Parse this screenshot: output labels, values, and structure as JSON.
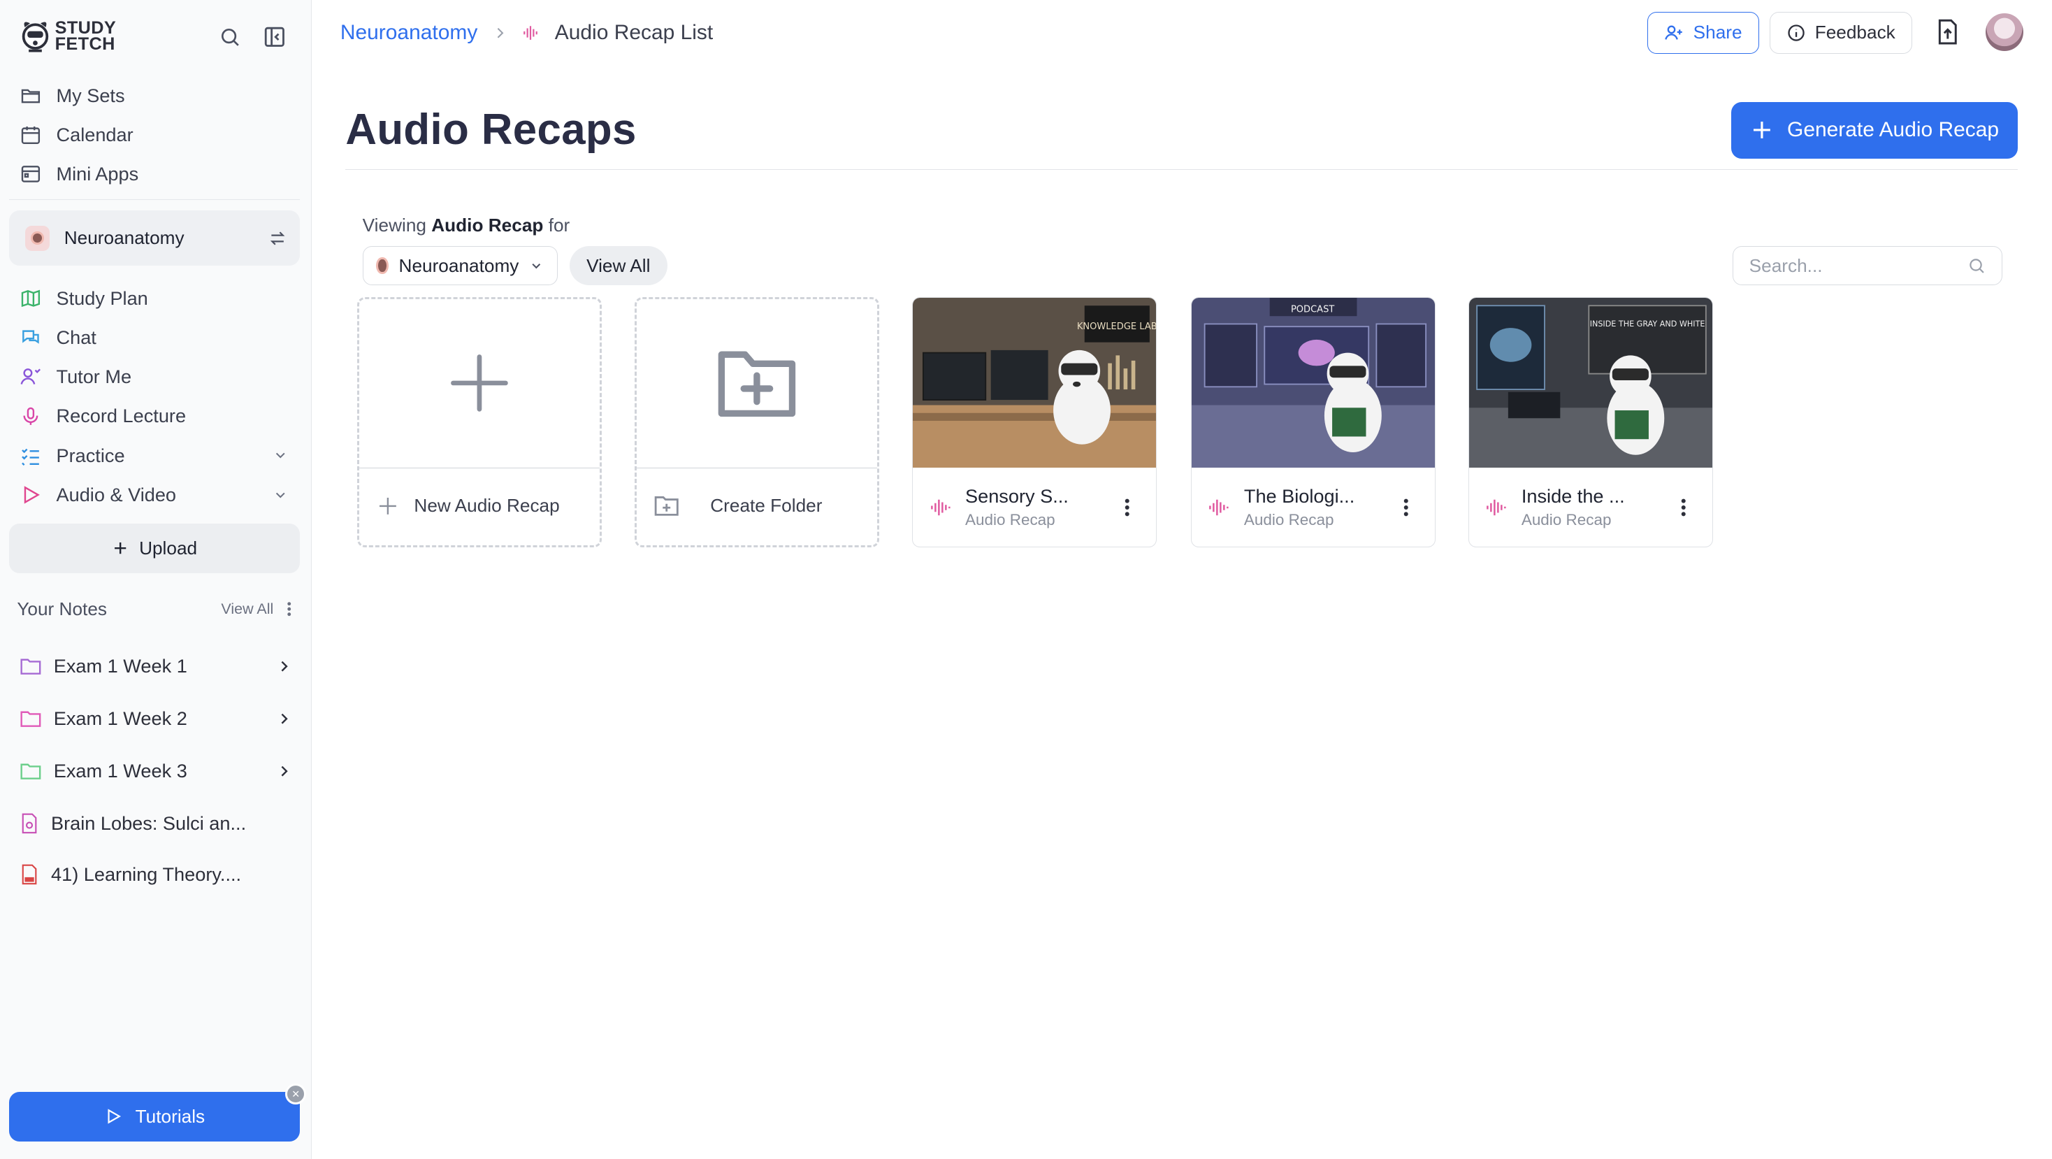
{
  "brand": {
    "line1": "STUDY",
    "line2": "FETCH"
  },
  "sidebar": {
    "nav": [
      {
        "label": "My Sets",
        "icon": "folder-icon"
      },
      {
        "label": "Calendar",
        "icon": "calendar-icon"
      },
      {
        "label": "Mini Apps",
        "icon": "apps-icon"
      }
    ],
    "current_set": "Neuroanatomy",
    "tools": [
      {
        "label": "Study Plan",
        "icon": "map-icon"
      },
      {
        "label": "Chat",
        "icon": "chat-icon"
      },
      {
        "label": "Tutor Me",
        "icon": "tutor-icon"
      },
      {
        "label": "Record Lecture",
        "icon": "microphone-icon"
      },
      {
        "label": "Practice",
        "icon": "checklist-icon"
      },
      {
        "label": "Audio & Video",
        "icon": "play-icon"
      }
    ],
    "upload_label": "Upload",
    "notes_title": "Your Notes",
    "notes_view_all": "View All",
    "notes": [
      {
        "label": "Exam 1 Week 1",
        "color": "#a66bd4"
      },
      {
        "label": "Exam 1 Week 2",
        "color": "#e05ab8"
      },
      {
        "label": "Exam 1 Week 3",
        "color": "#6ccf8b"
      },
      {
        "label": "Brain Lobes: Sulci an...",
        "color": "#c74fb5"
      },
      {
        "label": "41) Learning Theory....",
        "color": "#d94545"
      }
    ],
    "tutorials_label": "Tutorials",
    "tutorials_close": "×"
  },
  "header": {
    "breadcrumb_root": "Neuroanatomy",
    "breadcrumb_current": "Audio Recap List",
    "share_label": "Share",
    "feedback_label": "Feedback"
  },
  "main": {
    "title": "Audio Recaps",
    "generate_label": "Generate Audio Recap",
    "viewing_prefix": "Viewing",
    "viewing_bold": "Audio Recap",
    "viewing_suffix": "for",
    "filter_value": "Neuroanatomy",
    "view_all_label": "View All",
    "search_placeholder": "Search...",
    "new_card_label": "New Audio Recap",
    "folder_card_label": "Create Folder",
    "recaps": [
      {
        "name": "Sensory S...",
        "type": "Audio Recap",
        "thumb_text": "KNOWLEDGE LAB"
      },
      {
        "name": "The Biologi...",
        "type": "Audio Recap",
        "thumb_text": "PODCAST"
      },
      {
        "name": "Inside the ...",
        "type": "Audio Recap",
        "thumb_text": "INSIDE THE GRAY AND WHITE"
      }
    ]
  },
  "colors": {
    "accent": "#2f6fed",
    "audio": "#e05aa0",
    "title": "#2a2d45"
  }
}
